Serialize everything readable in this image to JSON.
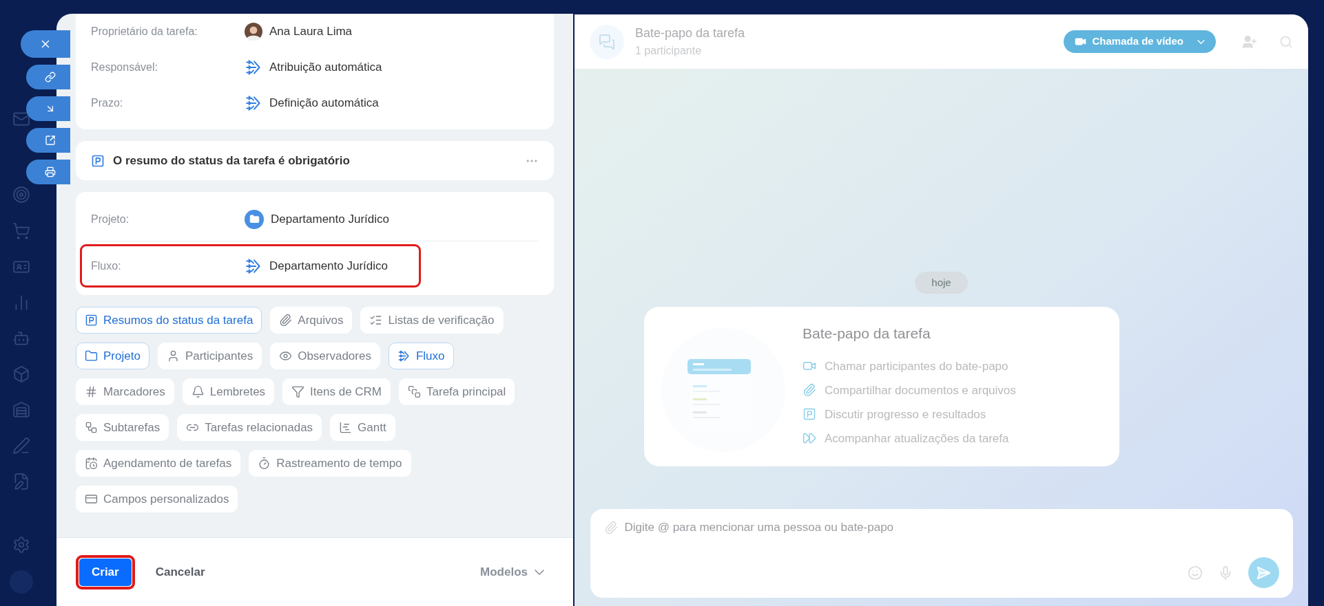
{
  "task_form": {
    "fields": [
      {
        "label": "Proprietário da tarefa:",
        "value": "Ana Laura Lima",
        "kind": "user"
      },
      {
        "label": "Responsável:",
        "value": "Atribuição automática",
        "kind": "flow"
      },
      {
        "label": "Prazo:",
        "value": "Definição automática",
        "kind": "flow"
      }
    ],
    "status_summary": {
      "title": "O resumo do status da tarefa é obrigatório"
    },
    "project_fields": [
      {
        "label": "Projeto:",
        "value": "Departamento Jurídico",
        "kind": "project",
        "highlighted": false
      },
      {
        "label": "Fluxo:",
        "value": "Departamento Jurídico",
        "kind": "flow",
        "highlighted": true
      }
    ],
    "chips": [
      {
        "label": "Resumos do status da tarefa",
        "kind": "status",
        "selected": true
      },
      {
        "label": "Arquivos",
        "kind": "files",
        "selected": false
      },
      {
        "label": "Listas de verificação",
        "kind": "checklist",
        "selected": false
      },
      {
        "label": "Projeto",
        "kind": "project",
        "selected": true
      },
      {
        "label": "Participantes",
        "kind": "participants",
        "selected": false
      },
      {
        "label": "Observadores",
        "kind": "observers",
        "selected": false
      },
      {
        "label": "Fluxo",
        "kind": "flow",
        "selected": true
      },
      {
        "label": "Marcadores",
        "kind": "tags",
        "selected": false
      },
      {
        "label": "Lembretes",
        "kind": "reminders",
        "selected": false
      },
      {
        "label": "Itens de CRM",
        "kind": "crm",
        "selected": false
      },
      {
        "label": "Tarefa principal",
        "kind": "parent",
        "selected": false
      },
      {
        "label": "Subtarefas",
        "kind": "subtasks",
        "selected": false
      },
      {
        "label": "Tarefas relacionadas",
        "kind": "related",
        "selected": false
      },
      {
        "label": "Gantt",
        "kind": "gantt",
        "selected": false
      },
      {
        "label": "Agendamento de tarefas",
        "kind": "schedule",
        "selected": false
      },
      {
        "label": "Rastreamento de tempo",
        "kind": "time",
        "selected": false
      },
      {
        "label": "Campos personalizados",
        "kind": "custom",
        "selected": false
      }
    ],
    "footer": {
      "create": "Criar",
      "create_highlighted": true,
      "cancel": "Cancelar",
      "templates": "Modelos"
    }
  },
  "chat": {
    "title": "Bate-papo da tarefa",
    "subtitle": "1 participante",
    "video_call": "Chamada de vídeo",
    "date": "hoje",
    "intro": {
      "title": "Bate-papo da tarefa",
      "features": [
        {
          "kind": "video",
          "text": "Chamar participantes do bate-papo"
        },
        {
          "kind": "files",
          "text": "Compartilhar documentos e arquivos"
        },
        {
          "kind": "status",
          "text": "Discutir progresso e resultados"
        },
        {
          "kind": "updates",
          "text": "Acompanhar atualizações da tarefa"
        }
      ]
    },
    "input": {
      "placeholder": "Digite @ para mencionar uma pessoa ou bate-papo"
    }
  }
}
